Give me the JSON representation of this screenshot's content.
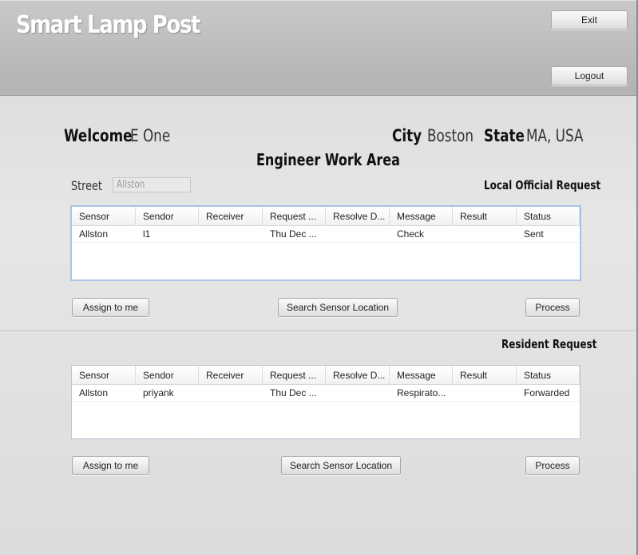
{
  "app": {
    "title": "Smart Lamp Post"
  },
  "header": {
    "exit_label": "Exit",
    "logout_label": "Logout"
  },
  "user": {
    "welcome_label": "Welcome",
    "name": "E One",
    "city_label": "City",
    "city": "Boston",
    "state_label": "State",
    "state": "MA, USA"
  },
  "work_area": {
    "title": "Engineer Work Area"
  },
  "street": {
    "label": "Street",
    "value": "Allston"
  },
  "local": {
    "title": "Local Official Request",
    "columns": [
      "Sensor",
      "Sendor",
      "Receiver",
      "Request ...",
      "Resolve D...",
      "Message",
      "Result",
      "Status"
    ],
    "rows": [
      [
        "Allston",
        "l1",
        "",
        "Thu Dec ...",
        "",
        "Check",
        "",
        "Sent"
      ]
    ],
    "assign_label": "Assign to me",
    "search_label": "Search Sensor Location",
    "process_label": "Process"
  },
  "resident": {
    "title": "Resident Request",
    "columns": [
      "Sensor",
      "Sendor",
      "Receiver",
      "Request ...",
      "Resolve D...",
      "Message",
      "Result",
      "Status"
    ],
    "rows": [
      [
        "Allston",
        "priyank",
        "",
        "Thu Dec ...",
        "",
        "Respirato...",
        "",
        "Forwarded"
      ]
    ],
    "assign_label": "Assign to me",
    "search_label": "Search Sensor Location",
    "process_label": "Process"
  }
}
